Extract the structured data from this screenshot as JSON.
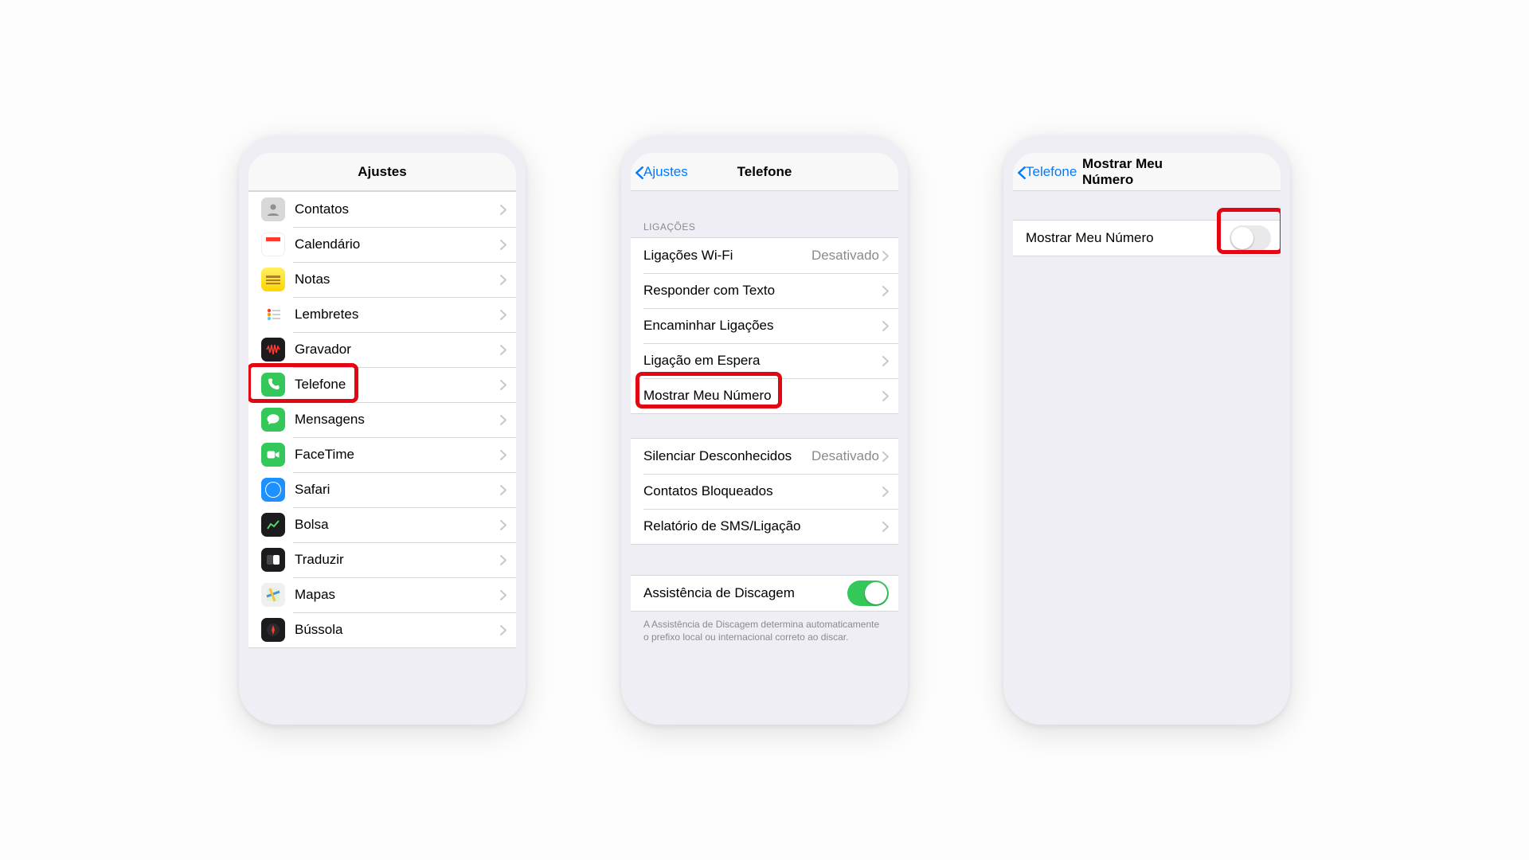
{
  "phone1": {
    "title": "Ajustes",
    "items": [
      {
        "label": "Contatos",
        "iconClass": "ic-contacts",
        "glyphSvg": "contacts"
      },
      {
        "label": "Calendário",
        "iconClass": "ic-calendar",
        "glyphSvg": "calendar"
      },
      {
        "label": "Notas",
        "iconClass": "ic-notes",
        "glyphSvg": "notes"
      },
      {
        "label": "Lembretes",
        "iconClass": "ic-reminders",
        "glyphSvg": "reminders"
      },
      {
        "label": "Gravador",
        "iconClass": "ic-voice",
        "glyphSvg": "voice"
      },
      {
        "label": "Telefone",
        "iconClass": "ic-phone",
        "glyphSvg": "phone"
      },
      {
        "label": "Mensagens",
        "iconClass": "ic-messages",
        "glyphSvg": "bubble"
      },
      {
        "label": "FaceTime",
        "iconClass": "ic-facetime",
        "glyphSvg": "video"
      },
      {
        "label": "Safari",
        "iconClass": "ic-safari",
        "glyphSvg": "safari"
      },
      {
        "label": "Bolsa",
        "iconClass": "ic-stocks",
        "glyphSvg": "stocks"
      },
      {
        "label": "Traduzir",
        "iconClass": "ic-translate",
        "glyphSvg": "translate"
      },
      {
        "label": "Mapas",
        "iconClass": "ic-maps",
        "glyphSvg": "maps"
      },
      {
        "label": "Bússola",
        "iconClass": "ic-compass",
        "glyphSvg": "compass"
      }
    ]
  },
  "phone2": {
    "back": "Ajustes",
    "title": "Telefone",
    "section1_header": "LIGAÇÕES",
    "group1": [
      {
        "label": "Ligações Wi-Fi",
        "value": "Desativado"
      },
      {
        "label": "Responder com Texto"
      },
      {
        "label": "Encaminhar Ligações"
      },
      {
        "label": "Ligação em Espera"
      },
      {
        "label": "Mostrar Meu Número"
      }
    ],
    "group2": [
      {
        "label": "Silenciar Desconhecidos",
        "value": "Desativado"
      },
      {
        "label": "Contatos Bloqueados"
      },
      {
        "label": "Relatório de SMS/Ligação"
      }
    ],
    "group3": [
      {
        "label": "Assistência de Discagem",
        "toggle": "on"
      }
    ],
    "footer": "A Assistência de Discagem determina automaticamente o prefixo local ou internacional correto ao discar."
  },
  "phone3": {
    "back": "Telefone",
    "title": "Mostrar Meu Número",
    "row_label": "Mostrar Meu Número",
    "toggle": "off"
  }
}
